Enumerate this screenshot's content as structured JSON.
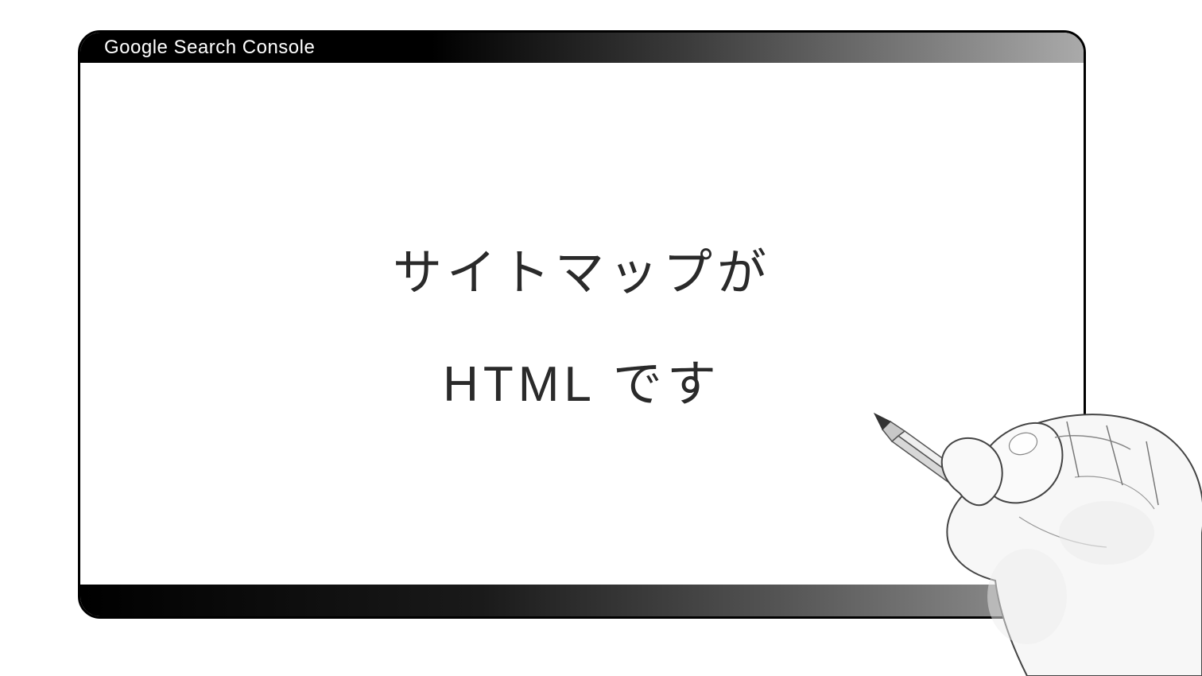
{
  "window": {
    "title": "Google Search Console"
  },
  "content": {
    "line1": "サイトマップが",
    "line2": "HTML です"
  }
}
